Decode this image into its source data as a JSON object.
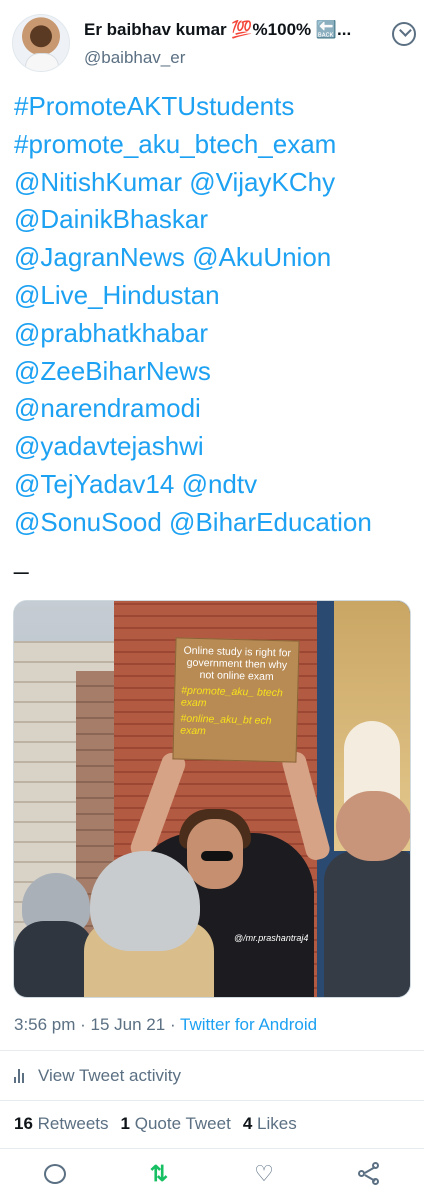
{
  "author": {
    "display_name": "Er baibhav kumar 💯%100% 🔙...",
    "handle": "@baibhav_er",
    "avatar_icon": "profile-photo",
    "more_icon": "chevron-down-circle-icon"
  },
  "tweet": {
    "lines": [
      "#PromoteAKTUstudents",
      "#promote_aku_btech_exam",
      "@NitishKumar @VijayKChy",
      "@DainikBhaskar",
      "@JagranNews @AkuUnion",
      "@Live_Hindustan",
      "@prabhatkhabar",
      "@ZeeBiharNews",
      "@narendramodi",
      "@yadavtejashwi",
      "@TejYadav14 @ndtv",
      "@SonuSood @BiharEducation"
    ],
    "trailing_text": "_",
    "link_color": "#1da1f2"
  },
  "media": {
    "sign_text": "Online study is right for government then why not online exam",
    "sign_promo_1": "#promote_aku_ btech exam",
    "sign_promo_2": "#online_aku_bt ech exam",
    "watermark": "@/mr.prashantraj4"
  },
  "meta": {
    "time": "3:56 pm",
    "separator": " · ",
    "date": "15 Jun 21",
    "source": "Twitter for Android"
  },
  "activity": {
    "label": "View Tweet activity",
    "icon": "bar-chart-icon"
  },
  "stats": {
    "retweets_count": "16",
    "retweets_label": "Retweets",
    "quotes_count": "1",
    "quotes_label": "Quote Tweet",
    "likes_count": "4",
    "likes_label": "Likes"
  },
  "actions": {
    "reply_icon": "reply-icon",
    "retweet_icon": "retweet-icon",
    "retweet_glyph": "⇅",
    "retweet_color": "#17bf63",
    "like_icon": "heart-icon",
    "like_glyph": "♡",
    "share_icon": "share-icon"
  }
}
